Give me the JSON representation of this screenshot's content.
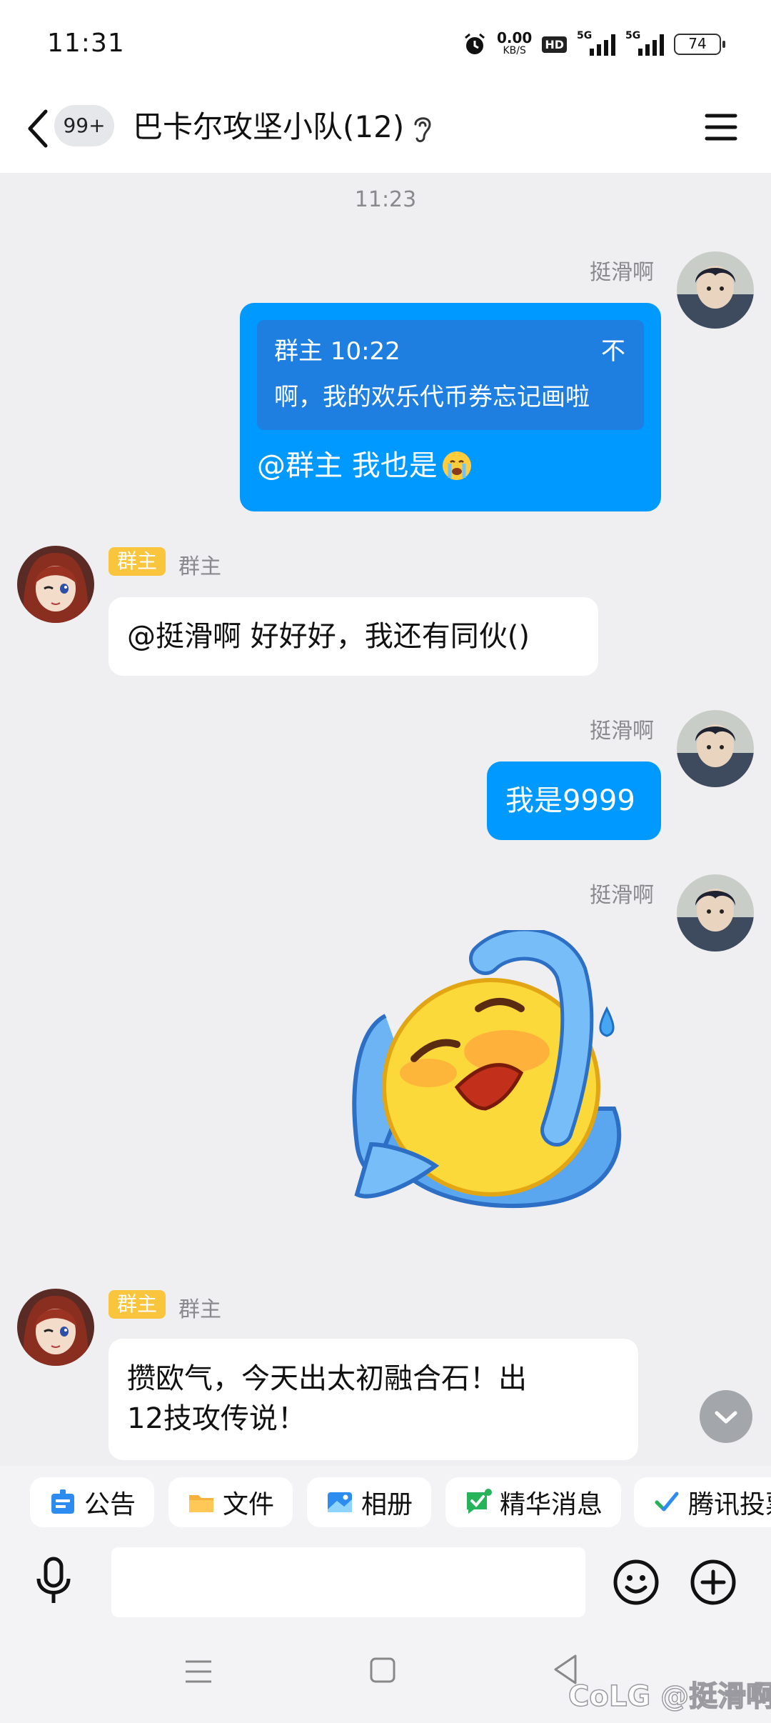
{
  "status_bar": {
    "time": "11:31",
    "net_speed": "0.00",
    "net_unit": "KB/S",
    "hd": "HD",
    "signal_1": "5G",
    "signal_2": "5G",
    "battery": "74"
  },
  "header": {
    "badge": "99+",
    "title": "巴卡尔攻坚小队(12)"
  },
  "chat": {
    "timestamp": "11:23",
    "messages": [
      {
        "sender": "挺滑啊",
        "quote_header": "群主 10:22",
        "quote_extra": "不",
        "quote_body": "啊，我的欢乐代币券忘记画啦",
        "text": "@群主 我也是"
      },
      {
        "role": "群主",
        "sender": "群主",
        "text": "@挺滑啊 好好好，我还有同伙()"
      },
      {
        "sender": "挺滑啊",
        "text": "我是9999"
      },
      {
        "sender": "挺滑啊",
        "sticker": "crying-face-sticker"
      },
      {
        "role": "群主",
        "sender": "群主",
        "text_line1": "攒欧气，今天出太初融合石！出",
        "text_line2": "12技攻传说！"
      }
    ]
  },
  "quick_bar": {
    "items": [
      "公告",
      "文件",
      "相册",
      "精华消息",
      "腾讯投票"
    ]
  },
  "input": {
    "placeholder": ""
  },
  "watermark": "CoLG @挺滑啊",
  "colors": {
    "outgoing_bubble": "#0099ff",
    "quote_bg": "#1f7fe0",
    "role_badge": "#f9c53d",
    "background": "#efeff1"
  }
}
